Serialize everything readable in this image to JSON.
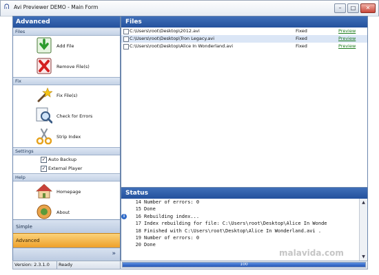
{
  "window": {
    "title": "Avi Previewer DEMO - Main Form",
    "buttons": {
      "minimize": "–",
      "maximize": "□",
      "close": "✕"
    }
  },
  "left_panel": {
    "header": "Advanced",
    "sections": {
      "files": "Files",
      "fix": "Fix",
      "settings": "Settings",
      "help": "Help"
    },
    "items": {
      "add_file": "Add File",
      "remove_files": "Remove File(s)",
      "fix_files": "Fix File(s)",
      "check_errors": "Check for Errors",
      "strip_index": "Strip Index",
      "homepage": "Homepage",
      "about": "About"
    },
    "settings": {
      "auto_backup": {
        "label": "Auto Backup",
        "checked": true
      },
      "external_player": {
        "label": "External Player",
        "checked": true
      }
    },
    "nav": {
      "simple": "Simple",
      "advanced": "Advanced",
      "more_icon": "chevron-double-down-icon"
    }
  },
  "files_panel": {
    "header": "Files",
    "rows": [
      {
        "path": "C:\\Users\\root\\Desktop\\2012.avi",
        "status": "Fixed",
        "action": "Preview",
        "selected": false
      },
      {
        "path": "C:\\Users\\root\\Desktop\\Tron Legacy.avi",
        "status": "Fixed",
        "action": "Preview",
        "selected": true
      },
      {
        "path": "C:\\Users\\root\\Desktop\\Alice In Wonderland.avi",
        "status": "Fixed",
        "action": "Preview",
        "selected": false
      }
    ]
  },
  "status_panel": {
    "header": "Status",
    "log": [
      {
        "num": "14",
        "text": "Number of errors: 0"
      },
      {
        "num": "15",
        "text": "Done"
      },
      {
        "num": "16",
        "text": "Rebuilding index..."
      },
      {
        "num": "17",
        "text": "Index rebuilding for file: C:\\Users\\root\\Desktop\\Alice In Wonde"
      },
      {
        "num": "18",
        "text": "Finished with C:\\Users\\root\\Desktop\\Alice In Wonderland.avi ."
      },
      {
        "num": "19",
        "text": "Number of errors: 0"
      },
      {
        "num": "20",
        "text": "Done"
      }
    ]
  },
  "statusbar": {
    "version": "Version: 2.3.1.0",
    "state": "Ready",
    "progress_value": 100,
    "progress_text": "100"
  },
  "watermark": "malavida.com",
  "colors": {
    "accent_blue": "#24519d",
    "orange_nav": "#eea02a",
    "preview_link": "#1a7a1a"
  }
}
